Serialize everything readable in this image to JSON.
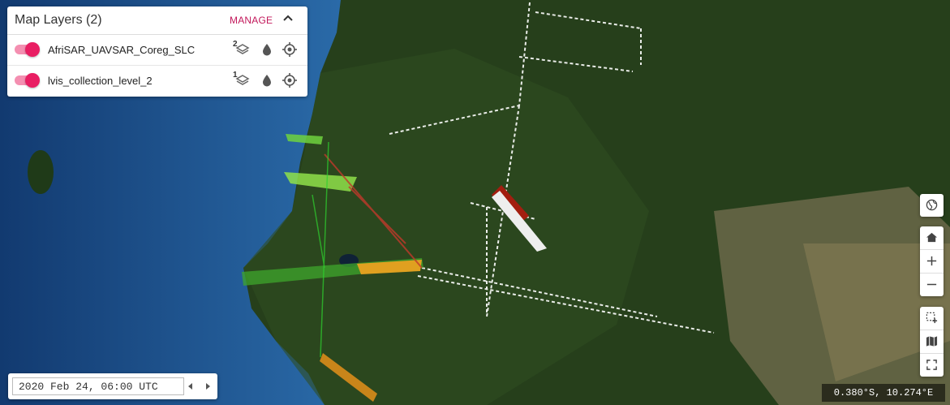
{
  "panel": {
    "title": "Map Layers (2)",
    "manage_label": "MANAGE",
    "layers": [
      {
        "name": "AfriSAR_UAVSAR_Coreg_SLC",
        "badge": "2",
        "enabled": true
      },
      {
        "name": "lvis_collection_level_2",
        "badge": "1",
        "enabled": true
      }
    ]
  },
  "timeline": {
    "date": "2020 Feb 24, 06:00 UTC"
  },
  "coordinates": "0.380°S, 10.274°E",
  "colors": {
    "accent": "#e91e63",
    "toggle_track": "#f48fb1",
    "ocean": "#1d4f86",
    "land": "#2c4a20"
  },
  "toolbar": {
    "icons": [
      "globe-icon",
      "home-icon",
      "zoom-in-icon",
      "zoom-out-icon",
      "select-area-icon",
      "map-icon",
      "fullscreen-icon"
    ]
  }
}
